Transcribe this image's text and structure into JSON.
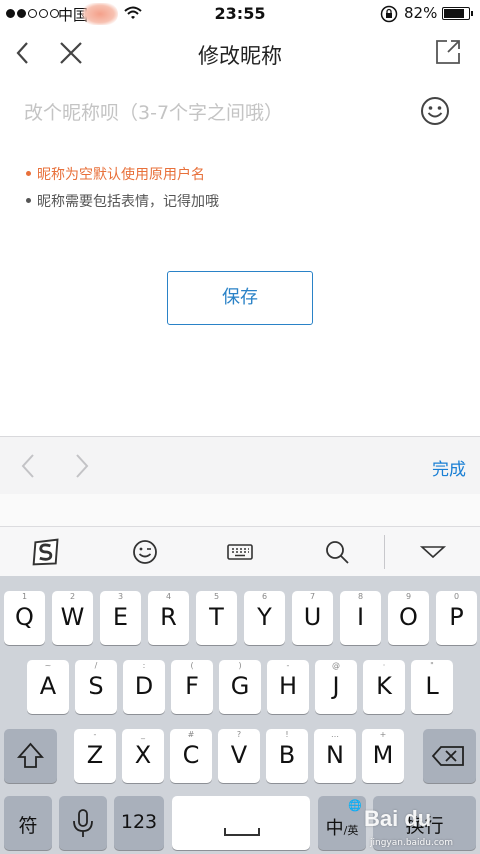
{
  "status_bar": {
    "carrier": "中国",
    "time": "23:55",
    "battery_percent": "82%",
    "battery_level": 0.82,
    "icons": [
      "signal-dots-icon",
      "wifi-icon",
      "rotation-lock-icon",
      "battery-icon"
    ]
  },
  "nav": {
    "title": "修改昵称",
    "icons": [
      "back-arrow-icon",
      "close-icon",
      "share-icon"
    ]
  },
  "form": {
    "nickname_value": "",
    "nickname_placeholder": "改个昵称呗（3-7个字之间哦）",
    "hints": [
      {
        "text": "昵称为空默认使用原用户名",
        "color": "#e8703a"
      },
      {
        "text": "昵称需要包括表情，记得加哦",
        "color": "#555555"
      }
    ],
    "save_label": "保存"
  },
  "accessory_bar": {
    "done_label": "完成",
    "accent": "#1a7fd4"
  },
  "keyboard_toolbar": {
    "icons": [
      "sogou-logo-icon",
      "emoji-icon",
      "keyboard-icon",
      "search-icon",
      "collapse-keyboard-icon"
    ]
  },
  "keyboard": {
    "row1": [
      {
        "main": "Q",
        "sub": "1"
      },
      {
        "main": "W",
        "sub": "2"
      },
      {
        "main": "E",
        "sub": "3"
      },
      {
        "main": "R",
        "sub": "4"
      },
      {
        "main": "T",
        "sub": "5"
      },
      {
        "main": "Y",
        "sub": "6"
      },
      {
        "main": "U",
        "sub": "7"
      },
      {
        "main": "I",
        "sub": "8"
      },
      {
        "main": "O",
        "sub": "9"
      },
      {
        "main": "P",
        "sub": "0"
      }
    ],
    "row2": [
      {
        "main": "A",
        "sub": "~"
      },
      {
        "main": "S",
        "sub": "/"
      },
      {
        "main": "D",
        "sub": ":"
      },
      {
        "main": "F",
        "sub": "("
      },
      {
        "main": "G",
        "sub": ")"
      },
      {
        "main": "H",
        "sub": "-"
      },
      {
        "main": "J",
        "sub": "@"
      },
      {
        "main": "K",
        "sub": "·"
      },
      {
        "main": "L",
        "sub": "\""
      }
    ],
    "row3": [
      {
        "main": "Z",
        "sub": "-"
      },
      {
        "main": "X",
        "sub": "_"
      },
      {
        "main": "C",
        "sub": "#"
      },
      {
        "main": "V",
        "sub": "?"
      },
      {
        "main": "B",
        "sub": "!"
      },
      {
        "main": "N",
        "sub": "…"
      },
      {
        "main": "M",
        "sub": "+"
      }
    ],
    "symbols_label": "符",
    "numbers_label": "123",
    "lang_main": "中",
    "lang_sub": "/英",
    "return_label": "换行",
    "icons": [
      "shift-icon",
      "backspace-icon",
      "microphone-icon",
      "space-icon",
      "globe-icon"
    ]
  },
  "watermark": {
    "logo": "Bai du",
    "url": "jingyan.baidu.com"
  }
}
